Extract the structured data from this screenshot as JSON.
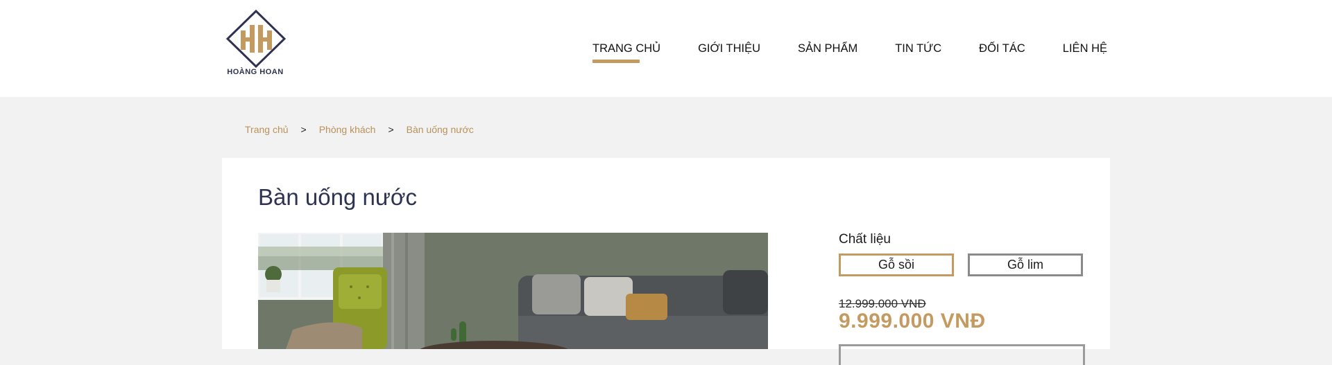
{
  "brand": {
    "name": "HOÀNG HOAN",
    "logo_letters": "HH"
  },
  "nav": {
    "items": [
      {
        "label": "TRANG CHỦ",
        "active": true
      },
      {
        "label": "GIỚI THIỆU",
        "active": false
      },
      {
        "label": "SẢN PHẨM",
        "active": false
      },
      {
        "label": "TIN TỨC",
        "active": false
      },
      {
        "label": "ĐỐI TÁC",
        "active": false
      },
      {
        "label": "LIÊN HỆ",
        "active": false
      }
    ]
  },
  "breadcrumb": {
    "items": [
      "Trang chủ",
      "Phòng khách",
      "Bàn uống nước"
    ],
    "separator": ">"
  },
  "product": {
    "title": "Bàn uống nước",
    "material_label": "Chất liệu",
    "materials": [
      "Gỗ sồi",
      "Gỗ lim"
    ],
    "selected_material": "Gỗ sồi",
    "old_price": "12.999.000 VNĐ",
    "price": "9.999.000 VNĐ"
  },
  "colors": {
    "accent": "#c39a60",
    "title": "#2e3353",
    "logo_navy": "#2e3150",
    "page_bg": "#f2f2f2"
  }
}
